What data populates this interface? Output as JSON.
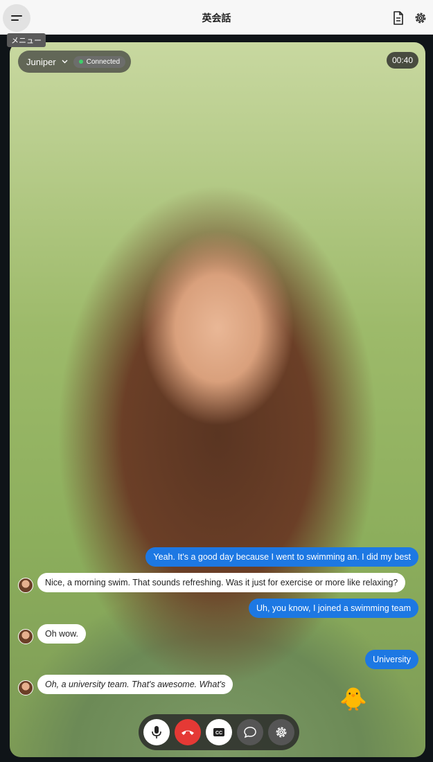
{
  "header": {
    "title": "英会話",
    "menu_tooltip": "メニュー",
    "icons": [
      "menu-icon",
      "document-icon",
      "gear-icon"
    ]
  },
  "call": {
    "caller_name": "Juniper",
    "status": "Connected",
    "timer": "00:40"
  },
  "messages": [
    {
      "role": "user",
      "text": "Yeah. It's a good day because I went to swimming an. I did my best"
    },
    {
      "role": "assistant",
      "text": "Nice, a morning swim. That sounds refreshing. Was it just for exercise or more like relaxing?"
    },
    {
      "role": "user",
      "text": "Uh, you know, I joined a swimming team"
    },
    {
      "role": "assistant",
      "text": "Oh wow."
    },
    {
      "role": "user",
      "text": "University"
    },
    {
      "role": "assistant",
      "text": "Oh, a university team. That's awesome. What's"
    }
  ],
  "emoji": "🐥",
  "controls": [
    "microphone-icon",
    "hang-up-icon",
    "captions-icon",
    "chat-icon",
    "gear-icon"
  ],
  "colors": {
    "user_bubble": "#1d78e3",
    "end_call": "#e53935",
    "connected": "#3fcf6c"
  }
}
